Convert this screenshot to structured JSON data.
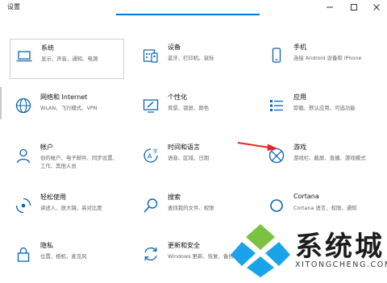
{
  "window": {
    "title": "设置",
    "controls": [
      "minimize-icon",
      "maximize-icon",
      "close-icon"
    ]
  },
  "accent_color": "#0078d7",
  "tiles": [
    {
      "title": "系统",
      "desc": "显示、声音、通知、电源",
      "icon": "laptop-icon"
    },
    {
      "title": "设备",
      "desc": "蓝牙、打印机、鼠标",
      "icon": "keyboard-devices-icon"
    },
    {
      "title": "手机",
      "desc": "连接 Android 设备和 iPhone",
      "icon": "phone-icon"
    },
    {
      "title": "网络和 Internet",
      "desc": "WLAN、飞行模式、VPN",
      "icon": "globe-icon"
    },
    {
      "title": "个性化",
      "desc": "背景、锁屏、颜色",
      "icon": "personalization-icon"
    },
    {
      "title": "应用",
      "desc": "卸载、默认应用、可选功能",
      "icon": "apps-list-icon"
    },
    {
      "title": "帐户",
      "desc": "你的帐户、电子邮件、同步设置、工作、其他人员",
      "icon": "person-icon"
    },
    {
      "title": "时间和语言",
      "desc": "语音、区域、日期",
      "icon": "time-language-icon"
    },
    {
      "title": "游戏",
      "desc": "游戏栏、截屏、直播、游戏模式",
      "icon": "xbox-icon"
    },
    {
      "title": "轻松使用",
      "desc": "讲述人、放大镜、高对比度",
      "icon": "ease-of-access-icon"
    },
    {
      "title": "搜索",
      "desc": "查找我的文件、权限",
      "icon": "search-icon"
    },
    {
      "title": "Cortana",
      "desc": "Cortana 语言、权限、通知",
      "icon": "cortana-icon"
    },
    {
      "title": "隐私",
      "desc": "位置、相机、麦克风",
      "icon": "lock-icon"
    },
    {
      "title": "更新和安全",
      "desc": "Windows 更新、恢复、备份",
      "icon": "update-sync-icon"
    }
  ],
  "annotation": {
    "icon": "red-arrow-icon",
    "color": "#e8262c"
  },
  "watermark": {
    "name": "系统城",
    "domain": "XITONGCHENG.COM",
    "colors": [
      "#1aa3e8",
      "#7bc142"
    ]
  }
}
